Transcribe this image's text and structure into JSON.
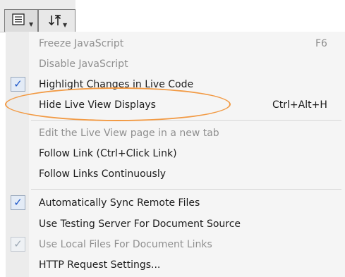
{
  "menu": {
    "items": [
      {
        "label": "Freeze JavaScript",
        "shortcut": "F6",
        "enabled": false,
        "checked": false
      },
      {
        "label": "Disable JavaScript",
        "shortcut": "",
        "enabled": false,
        "checked": false
      },
      {
        "label": "Highlight Changes in Live Code",
        "shortcut": "",
        "enabled": true,
        "checked": true
      },
      {
        "label": "Hide Live View Displays",
        "shortcut": "Ctrl+Alt+H",
        "enabled": true,
        "checked": false
      },
      {
        "label": "Edit the Live View page in a new tab",
        "shortcut": "",
        "enabled": false,
        "checked": false
      },
      {
        "label": "Follow Link (Ctrl+Click Link)",
        "shortcut": "",
        "enabled": true,
        "checked": false
      },
      {
        "label": "Follow Links Continuously",
        "shortcut": "",
        "enabled": true,
        "checked": false
      },
      {
        "label": "Automatically Sync Remote Files",
        "shortcut": "",
        "enabled": true,
        "checked": true
      },
      {
        "label": "Use Testing Server For Document Source",
        "shortcut": "",
        "enabled": true,
        "checked": false
      },
      {
        "label": "Use Local Files For Document Links",
        "shortcut": "",
        "enabled": false,
        "checked": true
      },
      {
        "label": "HTTP Request Settings...",
        "shortcut": "",
        "enabled": true,
        "checked": false
      }
    ]
  },
  "colors": {
    "highlight_ellipse": "#f29a44",
    "check_mark": "#1a55c8"
  },
  "icons": {
    "toolbar_menu_button": "list-menu-icon",
    "toolbar_sort_button": "sort-arrows-icon",
    "check": "check-icon"
  }
}
